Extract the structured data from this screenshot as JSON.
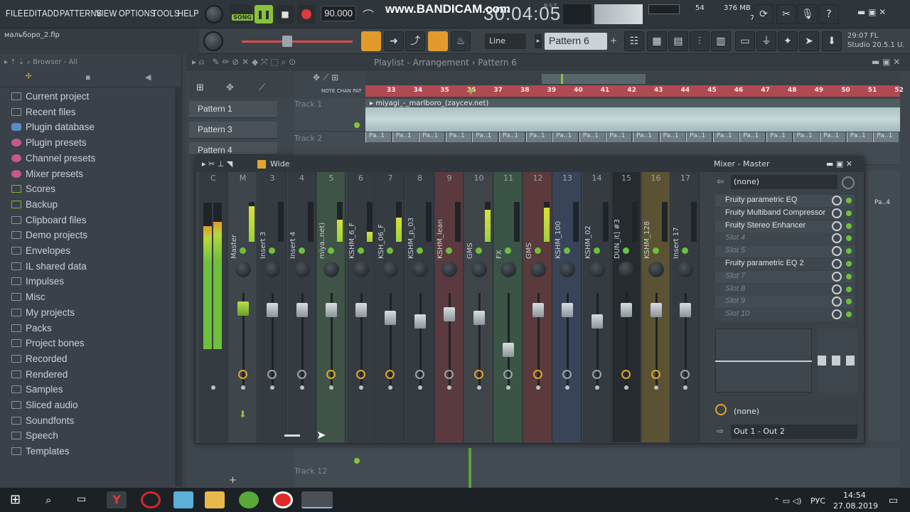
{
  "menu": [
    "FILE",
    "EDIT",
    "ADD",
    "PATTERNS",
    "VIEW",
    "OPTIONS",
    "TOOLS",
    "HELP"
  ],
  "transport": {
    "song_label": "SONG",
    "bpm": "90.000",
    "time": "30:04:05",
    "bst": "B:S:T"
  },
  "watermark": "www.BANDICAM.com",
  "cpu": {
    "mem": "376 MB",
    "cpu_val": "54",
    "voices": "7"
  },
  "project": {
    "file": "мальборо_2.flp"
  },
  "toolbar2": {
    "snap": "Line",
    "pattern": "Pattern 6",
    "fl_time": "29:07",
    "fl_label": "FL",
    "fl_version": "Studio 20.5.1 U."
  },
  "browser": {
    "header": "Browser - All",
    "items": [
      {
        "label": "Current project"
      },
      {
        "label": "Recent files"
      },
      {
        "label": "Plugin database"
      },
      {
        "label": "Plugin presets"
      },
      {
        "label": "Channel presets"
      },
      {
        "label": "Mixer presets"
      },
      {
        "label": "Scores"
      },
      {
        "label": "Backup"
      },
      {
        "label": "Clipboard files"
      },
      {
        "label": "Demo projects"
      },
      {
        "label": "Envelopes"
      },
      {
        "label": "IL shared data"
      },
      {
        "label": "Impulses"
      },
      {
        "label": "Misc"
      },
      {
        "label": "My projects"
      },
      {
        "label": "Packs"
      },
      {
        "label": "Project bones"
      },
      {
        "label": "Recorded"
      },
      {
        "label": "Rendered"
      },
      {
        "label": "Samples"
      },
      {
        "label": "Sliced audio"
      },
      {
        "label": "Soundfonts"
      },
      {
        "label": "Speech"
      },
      {
        "label": "Templates"
      }
    ]
  },
  "playlist": {
    "title": "Playlist - Arrangement",
    "pattern": "Pattern 6",
    "patterns": [
      "Pattern 1",
      "Pattern 3",
      "Pattern 4"
    ],
    "ruler": [
      "33",
      "34",
      "35",
      "36",
      "37",
      "38",
      "39",
      "40",
      "41",
      "42",
      "43",
      "44",
      "45",
      "46",
      "47",
      "48",
      "49",
      "50",
      "51",
      "52"
    ],
    "tracks": [
      "Track 1",
      "Track 2",
      "Track 12"
    ],
    "audio_clip": "miyagi_-_marlboro_(zaycev.net)",
    "clip_label": "Pa..1",
    "clip_label2": "Pa..4",
    "ruler_labels": {
      "note": "NOTE",
      "chan": "CHAN",
      "pat": "PAT"
    }
  },
  "mixer": {
    "mode": "Wide",
    "title": "Mixer - Master",
    "strips": [
      {
        "num": "C",
        "name": ""
      },
      {
        "num": "M",
        "name": "Master",
        "level": 0.9
      },
      {
        "num": "3",
        "name": "Insert 3",
        "level": 0
      },
      {
        "num": "4",
        "name": "Insert 4",
        "level": 0
      },
      {
        "num": "5",
        "name": "miya..net)",
        "level": 0.55
      },
      {
        "num": "6",
        "name": "KSHM_6_F",
        "level": 0.25
      },
      {
        "num": "7",
        "name": "KSH_06_F",
        "level": 0.6
      },
      {
        "num": "8",
        "name": "KSHM_p_03",
        "level": 0
      },
      {
        "num": "9",
        "name": "KSHM_lean",
        "level": 0
      },
      {
        "num": "10",
        "name": "GMS",
        "level": 0.8
      },
      {
        "num": "11",
        "name": "FX",
        "level": 0
      },
      {
        "num": "12",
        "name": "GMS",
        "level": 0.85
      },
      {
        "num": "13",
        "name": "KSHM_100",
        "level": 0
      },
      {
        "num": "14",
        "name": "KSHM_02",
        "level": 0
      },
      {
        "num": "15",
        "name": "DUN_it] #3",
        "level": 0
      },
      {
        "num": "16",
        "name": "KSHM_128",
        "level": 0
      },
      {
        "num": "17",
        "name": "Insert 17",
        "level": 0
      }
    ],
    "input": "(none)",
    "slots": [
      {
        "label": "Fruity parametric EQ",
        "empty": false
      },
      {
        "label": "Fruity Multiband Compressor",
        "empty": false
      },
      {
        "label": "Fruity Stereo Enhancer",
        "empty": false
      },
      {
        "label": "Slot 4",
        "empty": true
      },
      {
        "label": "Slot 5",
        "empty": true
      },
      {
        "label": "Fruity parametric EQ 2",
        "empty": false
      },
      {
        "label": "Slot 7",
        "empty": true
      },
      {
        "label": "Slot 8",
        "empty": true
      },
      {
        "label": "Slot 9",
        "empty": true
      },
      {
        "label": "Slot 10",
        "empty": true
      }
    ],
    "send": "(none)",
    "output": "Out 1 - Out 2"
  },
  "taskbar": {
    "lang": "РУС",
    "time": "14:54",
    "date": "27.08.2019"
  }
}
